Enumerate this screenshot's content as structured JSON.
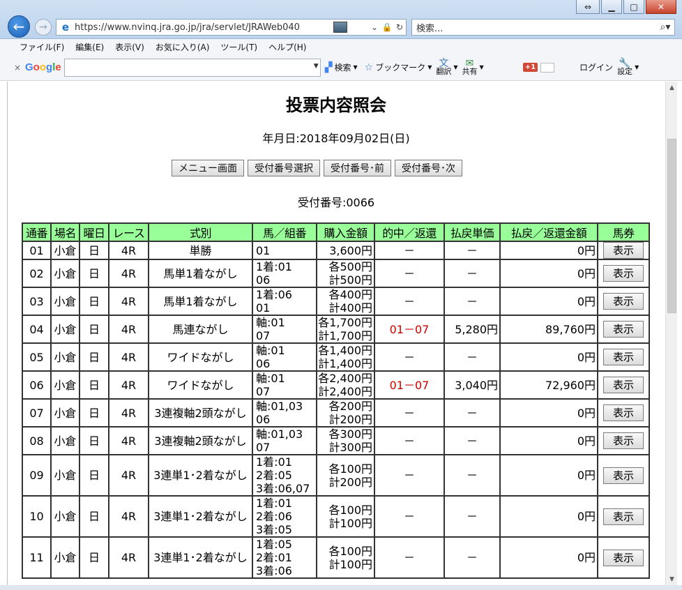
{
  "browser": {
    "url": "https://www.nvinq.jra.go.jp/jra/servlet/JRAWeb040",
    "search_placeholder": "検索...",
    "menu": [
      "ファイル(F)",
      "編集(E)",
      "表示(V)",
      "お気に入り(A)",
      "ツール(T)",
      "ヘルプ(H)"
    ],
    "google_bar": {
      "logo": "Google",
      "search_label": "検索",
      "bookmark_label": "ブックマーク",
      "translate_label": "翻訳",
      "share_label": "共有",
      "plus1_label": "+1",
      "login_label": "ログイン",
      "settings_label": "設定"
    }
  },
  "page": {
    "title": "投票内容照会",
    "date_line": "年月日:2018年09月02日(日)",
    "buttons": [
      "メニュー画面",
      "受付番号選択",
      "受付番号･前",
      "受付番号･次"
    ],
    "receipt": "受付番号:0066",
    "table": {
      "headers": [
        "通番",
        "場名",
        "曜日",
        "レース",
        "式別",
        "馬／組番",
        "購入金額",
        "的中／返還",
        "払戻単価",
        "払戻／返還金額",
        "馬券"
      ],
      "show_label": "表示",
      "rows": [
        {
          "no": "01",
          "place": "小倉",
          "day": "日",
          "race": "4R",
          "type": "単勝",
          "combo": [
            "01"
          ],
          "amount": [
            "3,600円"
          ],
          "hit": "－",
          "unit": "－",
          "payout": "0円"
        },
        {
          "no": "02",
          "place": "小倉",
          "day": "日",
          "race": "4R",
          "type": "馬単1着ながし",
          "combo": [
            "1着:01",
            "06"
          ],
          "amount": [
            "各500円",
            "計500円"
          ],
          "hit": "－",
          "unit": "－",
          "payout": "0円"
        },
        {
          "no": "03",
          "place": "小倉",
          "day": "日",
          "race": "4R",
          "type": "馬単1着ながし",
          "combo": [
            "1着:06",
            "01"
          ],
          "amount": [
            "各400円",
            "計400円"
          ],
          "hit": "－",
          "unit": "－",
          "payout": "0円"
        },
        {
          "no": "04",
          "place": "小倉",
          "day": "日",
          "race": "4R",
          "type": "馬連ながし",
          "combo": [
            "軸:01",
            "07"
          ],
          "amount": [
            "各1,700円",
            "計1,700円"
          ],
          "hit": "01－07",
          "unit": "5,280円",
          "payout": "89,760円"
        },
        {
          "no": "05",
          "place": "小倉",
          "day": "日",
          "race": "4R",
          "type": "ワイドながし",
          "combo": [
            "軸:01",
            "06"
          ],
          "amount": [
            "各1,400円",
            "計1,400円"
          ],
          "hit": "－",
          "unit": "－",
          "payout": "0円"
        },
        {
          "no": "06",
          "place": "小倉",
          "day": "日",
          "race": "4R",
          "type": "ワイドながし",
          "combo": [
            "軸:01",
            "07"
          ],
          "amount": [
            "各2,400円",
            "計2,400円"
          ],
          "hit": "01－07",
          "unit": "3,040円",
          "payout": "72,960円"
        },
        {
          "no": "07",
          "place": "小倉",
          "day": "日",
          "race": "4R",
          "type": "3連複軸2頭ながし",
          "combo": [
            "軸:01,03",
            "06"
          ],
          "amount": [
            "各200円",
            "計200円"
          ],
          "hit": "－",
          "unit": "－",
          "payout": "0円"
        },
        {
          "no": "08",
          "place": "小倉",
          "day": "日",
          "race": "4R",
          "type": "3連複軸2頭ながし",
          "combo": [
            "軸:01,03",
            "07"
          ],
          "amount": [
            "各300円",
            "計300円"
          ],
          "hit": "－",
          "unit": "－",
          "payout": "0円"
        },
        {
          "no": "09",
          "place": "小倉",
          "day": "日",
          "race": "4R",
          "type": "3連単1･2着ながし",
          "combo": [
            "1着:01",
            "2着:05",
            "3着:06,07"
          ],
          "amount": [
            "各100円",
            "計200円"
          ],
          "hit": "－",
          "unit": "－",
          "payout": "0円"
        },
        {
          "no": "10",
          "place": "小倉",
          "day": "日",
          "race": "4R",
          "type": "3連単1･2着ながし",
          "combo": [
            "1着:01",
            "2着:06",
            "3着:05"
          ],
          "amount": [
            "各100円",
            "計100円"
          ],
          "hit": "－",
          "unit": "－",
          "payout": "0円"
        },
        {
          "no": "11",
          "place": "小倉",
          "day": "日",
          "race": "4R",
          "type": "3連単1･2着ながし",
          "combo": [
            "1着:05",
            "2着:01",
            "3着:06"
          ],
          "amount": [
            "各100円",
            "計100円"
          ],
          "hit": "－",
          "unit": "－",
          "payout": "0円"
        }
      ]
    }
  },
  "colors": {
    "header_bg": "#99ff99",
    "hit_text": "#cc0000"
  }
}
